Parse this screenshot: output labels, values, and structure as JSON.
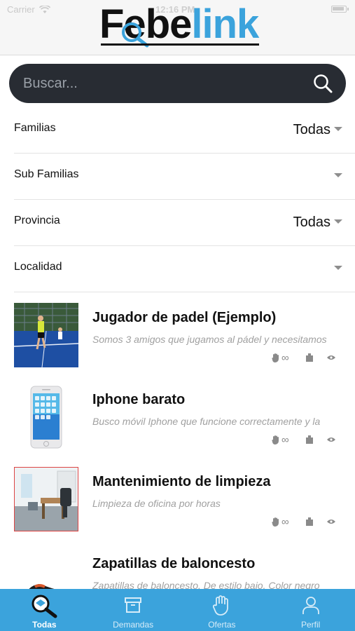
{
  "status": {
    "carrier": "Carrier",
    "time": "12:16 PM"
  },
  "brand": {
    "logo_dark": "Fe",
    "logo_mid": "be",
    "logo_accent": "link",
    "accent_color": "#3ba3dc"
  },
  "search": {
    "placeholder": "Buscar..."
  },
  "filters": [
    {
      "label": "Familias",
      "value": "Todas"
    },
    {
      "label": "Sub Familias",
      "value": ""
    },
    {
      "label": "Provincia",
      "value": "Todas"
    },
    {
      "label": "Localidad",
      "value": ""
    }
  ],
  "listings": [
    {
      "title": "Jugador de padel (Ejemplo)",
      "description": "Somos 3 amigos que jugamos al pádel y necesitamos",
      "thumb_icon": "padel-court-photo",
      "stats": "∞"
    },
    {
      "title": "Iphone barato",
      "description": "Busco móvil Iphone que funcione correctamente y la",
      "thumb_icon": "iphone-photo",
      "stats": "∞"
    },
    {
      "title": "Mantenimiento de limpieza",
      "description": "Limpieza de oficina por horas",
      "thumb_icon": "office-photo",
      "stats": "∞"
    },
    {
      "title": "Zapatillas de baloncesto",
      "description": "Zapatillas de baloncesto. De estilo bajo. Color negro",
      "thumb_icon": "sneaker-photo",
      "stats": ""
    }
  ],
  "tabs": [
    {
      "label": "Todas",
      "icon": "magnifier-icon",
      "active": true
    },
    {
      "label": "Demandas",
      "icon": "archive-box-icon",
      "active": false
    },
    {
      "label": "Ofertas",
      "icon": "hand-icon",
      "active": false
    },
    {
      "label": "Perfil",
      "icon": "user-icon",
      "active": false
    }
  ]
}
